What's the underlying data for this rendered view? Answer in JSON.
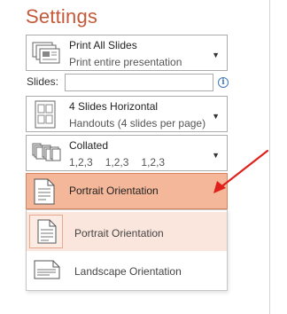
{
  "title": "Settings",
  "print_slides": {
    "primary": "Print All Slides",
    "secondary": "Print entire presentation",
    "icon": "print-all-slides-icon"
  },
  "slides": {
    "label": "Slides:",
    "value": "",
    "placeholder": ""
  },
  "handouts": {
    "primary": "4 Slides Horizontal",
    "secondary": "Handouts (4 slides per page)",
    "icon": "four-slides-horizontal-icon"
  },
  "collation": {
    "primary": "Collated",
    "sequence": [
      "1,2,3",
      "1,2,3",
      "1,2,3"
    ],
    "icon": "collated-icon"
  },
  "orientation": {
    "selected": "Portrait Orientation",
    "options": [
      {
        "label": "Portrait Orientation",
        "icon": "portrait-page-icon"
      },
      {
        "label": "Landscape Orientation",
        "icon": "landscape-page-icon"
      }
    ]
  },
  "colors": {
    "accent": "#c55a3b",
    "selected_bg": "#f4b79a",
    "hover_bg": "#fbe6dd",
    "arrow": "#e0201b"
  }
}
